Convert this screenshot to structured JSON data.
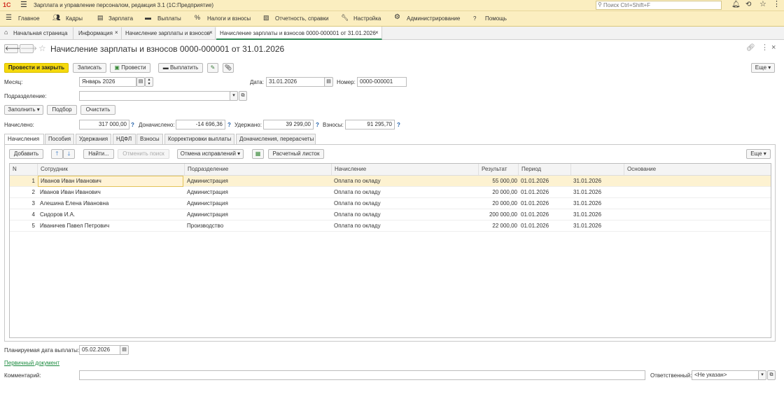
{
  "app": {
    "logo": "1С",
    "title": "Зарплата и управление персоналом, редакция 3.1  (1С:Предприятие)",
    "search_placeholder": "Поиск Ctrl+Shift+F"
  },
  "menu": [
    "Главное",
    "Кадры",
    "Зарплата",
    "Выплаты",
    "Налоги и взносы",
    "Отчетность, справки",
    "Настройка",
    "Администрирование",
    "Помощь"
  ],
  "tabs": [
    "Начальная страница",
    "Информация",
    "Начисление зарплаты и взносов",
    "Начисление зарплаты и взносов 0000-000001 от 31.01.2026"
  ],
  "document": {
    "title": "Начисление зарплаты и взносов 0000-000001 от 31.01.2026"
  },
  "toolbar": {
    "post_close": "Провести и закрыть",
    "save": "Записать",
    "post": "Провести",
    "pay": "Выплатить",
    "more": "Еще"
  },
  "form": {
    "month_label": "Месяц:",
    "month_value": "Январь 2026",
    "date_label": "Дата:",
    "date_value": "31.01.2026",
    "number_label": "Номер:",
    "number_value": "0000-000001",
    "division_label": "Подразделение:",
    "division_value": "",
    "fill_btn": "Заполнить",
    "select_btn": "Подбор",
    "clear_btn": "Очистить",
    "accrued_label": "Начислено:",
    "accrued_value": "317 000,00",
    "additional_label": "Доначислено:",
    "additional_value": "-14 696,36",
    "withheld_label": "Удержано:",
    "withheld_value": "39 299,00",
    "contrib_label": "Взносы:",
    "contrib_value": "91 295,70",
    "q": "?"
  },
  "inner_tabs": [
    "Начисления",
    "Пособия",
    "Удержания",
    "НДФЛ",
    "Взносы",
    "Корректировки выплаты",
    "Доначисления, перерасчеты"
  ],
  "table_toolbar": {
    "add": "Добавить",
    "find": "Найти...",
    "cancel_search": "Отменить поиск",
    "cancel_fix": "Отмена исправлений",
    "payslip": "Расчетный листок",
    "more": "Еще"
  },
  "table": {
    "columns": [
      "N",
      "Сотрудник",
      "Подразделение",
      "Начисление",
      "Результат",
      "Период",
      "",
      "Основание"
    ],
    "rows": [
      {
        "n": "1",
        "employee": "Иванов Иван Иванович",
        "division": "Администрация",
        "accrual": "Оплата по окладу",
        "result": "55 000,00",
        "period": "01.01.2026",
        "end": "31.01.2026",
        "basis": ""
      },
      {
        "n": "2",
        "employee": "Иванов Иван Иванович",
        "division": "Администрация",
        "accrual": "Оплата по окладу",
        "result": "20 000,00",
        "period": "01.01.2026",
        "end": "31.01.2026",
        "basis": ""
      },
      {
        "n": "3",
        "employee": "Алешина Елена Ивановна",
        "division": "Администрация",
        "accrual": "Оплата по окладу",
        "result": "20 000,00",
        "period": "01.01.2026",
        "end": "31.01.2026",
        "basis": ""
      },
      {
        "n": "4",
        "employee": "Сидоров И.А.",
        "division": "Администрация",
        "accrual": "Оплата по окладу",
        "result": "200 000,00",
        "period": "01.01.2026",
        "end": "31.01.2026",
        "basis": ""
      },
      {
        "n": "5",
        "employee": "Иваничев Павел Петрович",
        "division": "Производство",
        "accrual": "Оплата по окладу",
        "result": "22 000,00",
        "period": "01.01.2026",
        "end": "31.01.2026",
        "basis": ""
      }
    ]
  },
  "footer": {
    "pay_date_label": "Планируемая дата выплаты:",
    "pay_date_value": "05.02.2026",
    "primary_doc": "Первичный документ",
    "comment_label": "Комментарий:",
    "comment_value": "",
    "responsible_label": "Ответственный:",
    "responsible_value": "<Не указан>"
  },
  "colors": {
    "accent": "#f5d90c",
    "menu_bg": "#fbeec0",
    "selected_row": "#fdf2d1",
    "link": "#1a8a3e",
    "help": "#1f5ea8"
  }
}
